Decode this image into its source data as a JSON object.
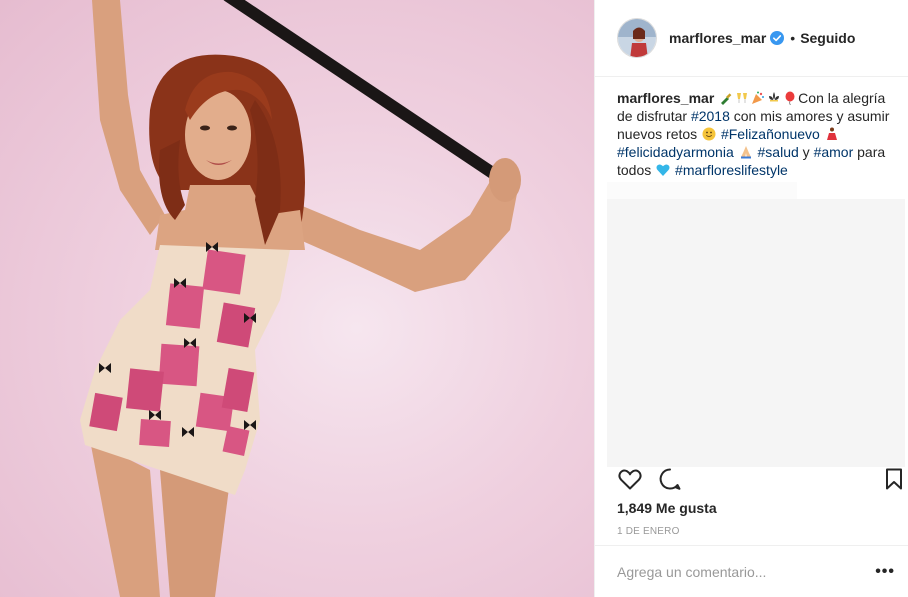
{
  "post": {
    "username": "marflores_mar",
    "separator": "•",
    "follow_status": "Seguido"
  },
  "caption": {
    "username": "marflores_mar",
    "text_1": "Con la alegría de disfrutar ",
    "tag_2018": "#2018",
    "text_2": " con mis amores y asumir nuevos retos ",
    "tag_felizanonuevo": "#Felizañonuevo",
    "tag_felicidad": "#felicidadyarmonia",
    "tag_salud": "#salud",
    "text_3": " y ",
    "tag_amor": "#amor",
    "text_4": " para todos ",
    "tag_lifestyle": "#marfloreslifestyle"
  },
  "icons": {
    "like": "heart-icon",
    "comment": "comment-icon",
    "save": "bookmark-icon",
    "verified": "verified-badge-icon"
  },
  "stats": {
    "likes": "1,849 Me gusta",
    "date": "1 DE ENERO"
  },
  "comment": {
    "placeholder": "Agrega un comentario...",
    "more": "•••"
  },
  "colors": {
    "hashtag": "#003569",
    "verified": "#3897f0",
    "muted": "#999999",
    "text": "#262626"
  }
}
